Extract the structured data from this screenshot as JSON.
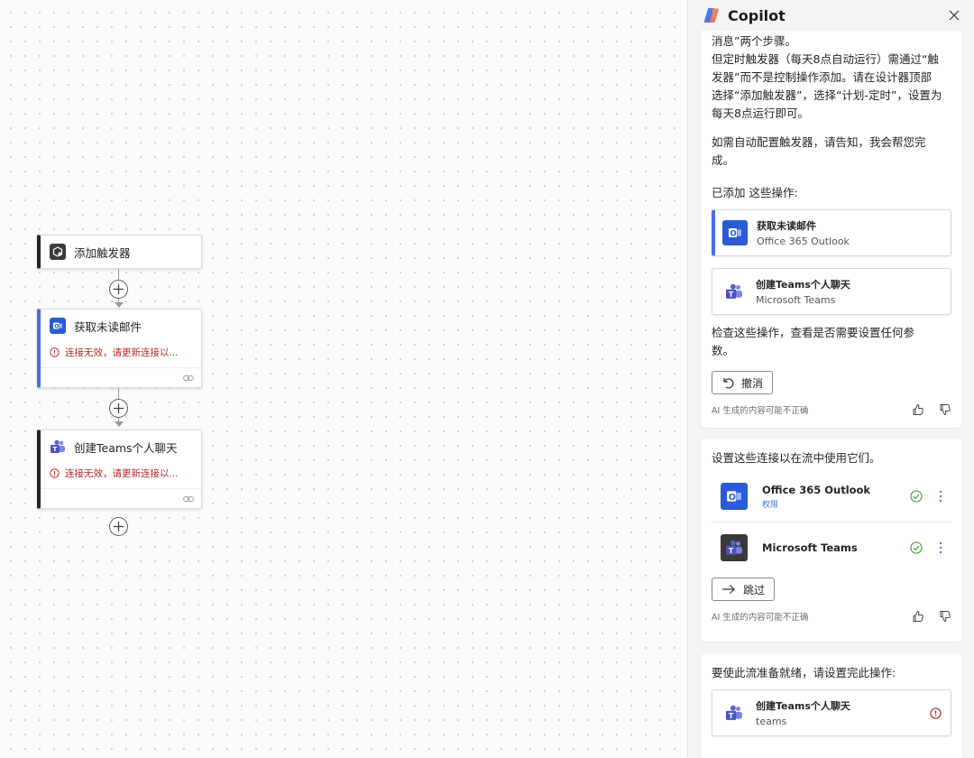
{
  "flow": {
    "trigger": {
      "label": "添加触发器"
    },
    "step1": {
      "title": "获取未读邮件",
      "error": "连接无效，请更新连接以..."
    },
    "step2": {
      "title": "创建Teams个人聊天",
      "error": "连接无效，请更新连接以..."
    }
  },
  "panel": {
    "title": "Copilot",
    "message": {
      "para1_lines": [
        "消息”两个步骤。",
        "但定时触发器（每天8点自动运行）需通过“触",
        "发器”而不是控制操作添加。请在设计器顶部",
        "选择“添加触发器”，选择“计划-定时”，设置为",
        "每天8点运行即可。"
      ],
      "para2_lines": [
        "如需自动配置触发器，请告知，我会帮您完",
        "成。"
      ],
      "added_label": "已添加 这些操作:",
      "op1": {
        "name": "获取未读邮件",
        "connector": "Office 365 Outlook"
      },
      "op2": {
        "name": "创建Teams个人聊天",
        "connector": "Microsoft Teams"
      },
      "review_lines": [
        "检查这些操作，查看是否需要设置任何参",
        "数。"
      ],
      "undo_label": "撤消",
      "ai_note": "AI 生成的内容可能不正确"
    },
    "connections": {
      "intro": "设置这些连接以在流中使用它们。",
      "items": [
        {
          "name": "Office 365 Outlook",
          "sub": "权限"
        },
        {
          "name": "Microsoft Teams",
          "sub": ""
        }
      ],
      "skip_label": "跳过",
      "ai_note": "AI 生成的内容可能不正确"
    },
    "finish": {
      "intro": "要使此流准备就绪，请设置完此操作:",
      "op": {
        "name": "创建Teams个人聊天",
        "connector": "teams"
      }
    }
  },
  "colors": {
    "accent": "#4a6ee0",
    "outlook": "#2a5bd7",
    "teams": "#5b5fc7",
    "error": "#b02a2a",
    "success": "#3a9a3a"
  },
  "icons": [
    "outlook-icon",
    "teams-icon",
    "trigger-icon",
    "copilot-logo",
    "close-icon",
    "plus-icon",
    "error-icon",
    "link-icon",
    "undo-icon",
    "arrow-right-icon",
    "thumbs-up-icon",
    "thumbs-down-icon",
    "check-circle-icon",
    "more-icon"
  ]
}
